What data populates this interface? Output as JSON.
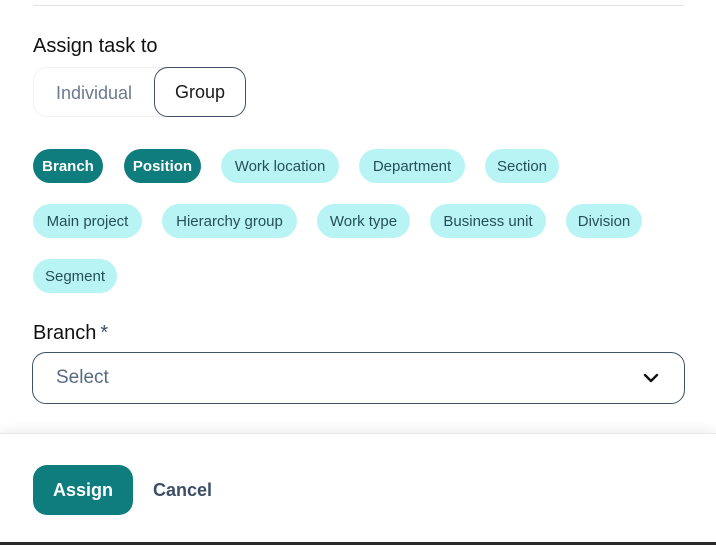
{
  "assign": {
    "title": "Assign task to",
    "options": [
      "Individual",
      "Group"
    ],
    "selected": "Group"
  },
  "chips": [
    {
      "label": "Branch",
      "active": true
    },
    {
      "label": "Position",
      "active": true
    },
    {
      "label": "Work location",
      "active": false
    },
    {
      "label": "Department",
      "active": false
    },
    {
      "label": "Section",
      "active": false
    },
    {
      "label": "Main project",
      "active": false
    },
    {
      "label": "Hierarchy group",
      "active": false
    },
    {
      "label": "Work type",
      "active": false
    },
    {
      "label": "Business unit",
      "active": false
    },
    {
      "label": "Division",
      "active": false
    },
    {
      "label": "Segment",
      "active": false
    }
  ],
  "field": {
    "label": "Branch",
    "required_mark": "*",
    "value": "Select"
  },
  "footer": {
    "assign_label": "Assign",
    "cancel_label": "Cancel"
  },
  "colors": {
    "accent": "#0f7d7d",
    "chip_inactive_bg": "#b9f4f4"
  }
}
